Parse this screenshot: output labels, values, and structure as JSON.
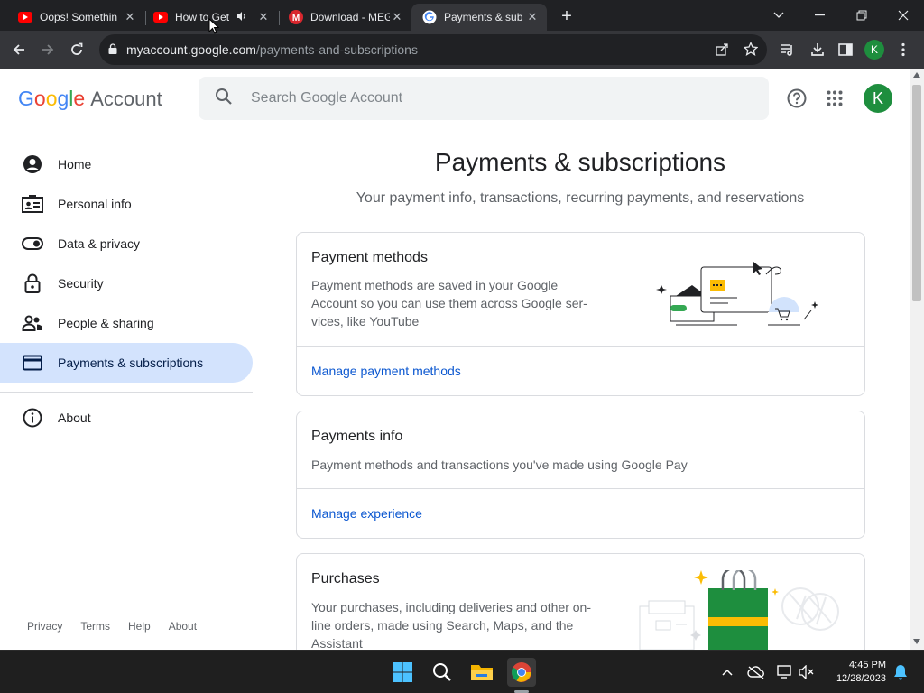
{
  "browser": {
    "tabs": [
      {
        "title": "Oops! Somethin",
        "favicon": "youtube-icon"
      },
      {
        "title": "How to Get",
        "favicon": "youtube-icon",
        "audio": true
      },
      {
        "title": "Download - MEG",
        "favicon": "mega-icon"
      },
      {
        "title": "Payments & sub",
        "favicon": "google-icon",
        "active": true
      }
    ],
    "url_host": "myaccount.google.com",
    "url_path": "/payments-and-subscriptions",
    "profile_initial": "K"
  },
  "header": {
    "logo_google": [
      "G",
      "o",
      "o",
      "g",
      "l",
      "e"
    ],
    "logo_account": "Account",
    "search_placeholder": "Search Google Account",
    "avatar_initial": "K"
  },
  "sidebar": {
    "items": [
      {
        "label": "Home",
        "icon": "account-circle-icon"
      },
      {
        "label": "Personal info",
        "icon": "id-card-icon"
      },
      {
        "label": "Data & privacy",
        "icon": "toggle-icon"
      },
      {
        "label": "Security",
        "icon": "lock-icon"
      },
      {
        "label": "People & sharing",
        "icon": "people-icon"
      },
      {
        "label": "Payments & subscriptions",
        "icon": "credit-card-icon",
        "active": true
      },
      {
        "label": "About",
        "icon": "info-icon"
      }
    ],
    "footer": [
      "Privacy",
      "Terms",
      "Help",
      "About"
    ]
  },
  "main": {
    "title": "Payments & subscriptions",
    "subtitle": "Your payment info, transactions, recurring payments, and reservations",
    "cards": [
      {
        "title": "Payment methods",
        "description": "Payment methods are saved in your Google Account so you can use them across Google ser-vices, like YouTube",
        "link": "Manage payment methods"
      },
      {
        "title": "Payments info",
        "description": "Payment methods and transactions you've made using Google Pay",
        "link": "Manage experience"
      },
      {
        "title": "Purchases",
        "description": "Your purchases, including deliveries and other on-line orders, made using Search, Maps, and the Assistant"
      }
    ]
  },
  "taskbar": {
    "time": "4:45 PM",
    "date": "12/28/2023"
  },
  "colors": {
    "active_nav": "#d3e3fd",
    "link": "#0b57d0",
    "avatar": "#1e8e3e"
  }
}
